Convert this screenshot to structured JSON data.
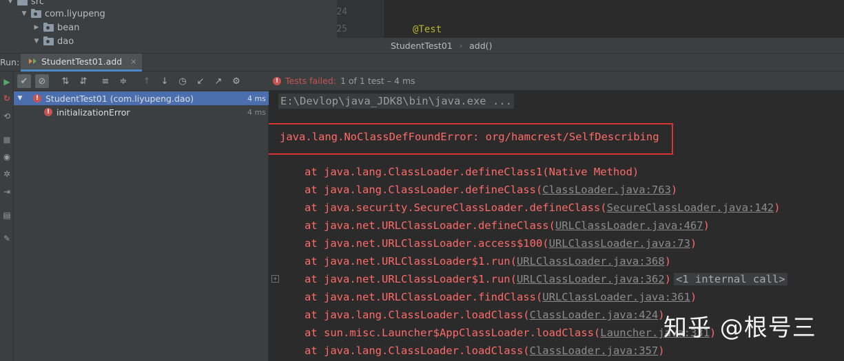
{
  "project_tree": {
    "items": [
      {
        "label": "src",
        "expanded": true
      },
      {
        "label": "com.liyupeng",
        "expanded": true
      },
      {
        "label": "bean",
        "expanded": false
      },
      {
        "label": "dao",
        "expanded": true
      }
    ]
  },
  "editor": {
    "line_numbers": [
      "24",
      "25"
    ],
    "code": {
      "annotation": "@Test"
    },
    "breadcrumbs": [
      "StudentTest01",
      "add()"
    ],
    "breadcrumb_sep": "›"
  },
  "run_panel": {
    "label": "Run:",
    "tab_title": "StudentTest01.add",
    "tab_close": "×"
  },
  "toolbar": {
    "icons": [
      "check-icon",
      "stop-circle-icon",
      "sort-alpha-icon",
      "sort-duration-icon",
      "expand-all-icon",
      "collapse-all-icon",
      "arrow-up-icon",
      "arrow-down-icon",
      "history-icon",
      "import-icon",
      "export-icon",
      "gear-icon"
    ]
  },
  "test_tree": {
    "items": [
      {
        "name": "StudentTest01 (com.liyupeng.dao)",
        "time": "4 ms",
        "selected": true,
        "status": "failed"
      },
      {
        "name": "initializationError",
        "time": "4 ms",
        "selected": false,
        "status": "failed"
      }
    ]
  },
  "status": {
    "failed_text": "Tests failed:",
    "count_text": "1 of 1 test – 4 ms"
  },
  "console": {
    "command": "E:\\Devlop\\java_JDK8\\bin\\java.exe ...",
    "error": "java.lang.NoClassDefFoundError: org/hamcrest/SelfDescribing",
    "stack": [
      {
        "text": "at java.lang.ClassLoader.defineClass1(Native Method)",
        "link": "",
        "suffix": "",
        "badge": ""
      },
      {
        "text": "at java.lang.ClassLoader.defineClass(",
        "link": "ClassLoader.java:763",
        "suffix": ")",
        "badge": ""
      },
      {
        "text": "at java.security.SecureClassLoader.defineClass(",
        "link": "SecureClassLoader.java:142",
        "suffix": ")",
        "badge": ""
      },
      {
        "text": "at java.net.URLClassLoader.defineClass(",
        "link": "URLClassLoader.java:467",
        "suffix": ")",
        "badge": ""
      },
      {
        "text": "at java.net.URLClassLoader.access$100(",
        "link": "URLClassLoader.java:73",
        "suffix": ")",
        "badge": ""
      },
      {
        "text": "at java.net.URLClassLoader$1.run(",
        "link": "URLClassLoader.java:368",
        "suffix": ")",
        "badge": ""
      },
      {
        "text": "at java.net.URLClassLoader$1.run(",
        "link": "URLClassLoader.java:362",
        "suffix": ")",
        "badge": "<1 internal call>"
      },
      {
        "text": "at java.net.URLClassLoader.findClass(",
        "link": "URLClassLoader.java:361",
        "suffix": ")",
        "badge": ""
      },
      {
        "text": "at java.lang.ClassLoader.loadClass(",
        "link": "ClassLoader.java:424",
        "suffix": ")",
        "badge": ""
      },
      {
        "text": "at sun.misc.Launcher$AppClassLoader.loadClass(",
        "link": "Launcher.java:331",
        "suffix": ")",
        "badge": ""
      },
      {
        "text": "at java.lang.ClassLoader.loadClass(",
        "link": "ClassLoader.java:357",
        "suffix": ")",
        "badge": ""
      }
    ]
  },
  "watermark": "知乎 @根号三",
  "colors": {
    "error_red": "#ff6b68",
    "selection_blue": "#4b6eaf",
    "panel_bg": "#3c3f41",
    "editor_bg": "#2b2b2b",
    "annotation_yellow": "#bbb529"
  }
}
